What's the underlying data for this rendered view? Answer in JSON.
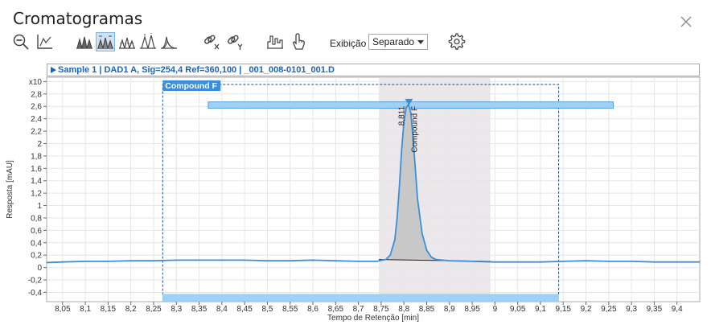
{
  "window": {
    "title": "Cromatogramas",
    "close_icon": "close-icon"
  },
  "toolbar": {
    "buttons": [
      {
        "name": "zoom-out-icon",
        "active": false
      },
      {
        "name": "autoscale-icon",
        "active": false
      },
      {
        "name": "overlay-peaks-icon",
        "active": false
      },
      {
        "name": "separate-peaks-icon",
        "active": true
      },
      {
        "name": "stacked-peaks-icon",
        "active": false
      },
      {
        "name": "peak-labels-icon",
        "active": false
      },
      {
        "name": "peak-shape-icon",
        "active": false
      },
      {
        "name": "link-x-icon",
        "active": false
      },
      {
        "name": "link-y-icon",
        "active": false
      },
      {
        "name": "integration-icon",
        "active": false
      },
      {
        "name": "pointer-hand-icon",
        "active": false
      }
    ],
    "display_label": "Exibição",
    "display_value": "Separado",
    "settings_icon": "gear-icon"
  },
  "chart_header": "Sample 1 | DAD1 A, Sig=254,4 Ref=360,100 | _001_008-0101_001.D",
  "chart_data": {
    "type": "line",
    "xlabel": "Tempo de Retenção [min]",
    "ylabel": "Resposta [mAU]",
    "y_multiplier_label": "x10",
    "xlim": [
      8.015,
      9.45
    ],
    "ylim": [
      -0.55,
      3.07
    ],
    "x_ticks": [
      8.05,
      8.1,
      8.15,
      8.2,
      8.25,
      8.3,
      8.35,
      8.4,
      8.45,
      8.5,
      8.55,
      8.6,
      8.65,
      8.7,
      8.75,
      8.8,
      8.85,
      8.9,
      8.95,
      9.0,
      9.05,
      9.1,
      9.15,
      9.2,
      9.25,
      9.3,
      9.35,
      9.4
    ],
    "x_tick_labels": [
      "8,05",
      "8,1",
      "8,15",
      "8,2",
      "8,25",
      "8,3",
      "8,35",
      "8,4",
      "8,45",
      "8,5",
      "8,55",
      "8,6",
      "8,65",
      "8,7",
      "8,75",
      "8,8",
      "8,85",
      "8,9",
      "8,95",
      "9",
      "9,05",
      "9,1",
      "9,15",
      "9,2",
      "9,25",
      "9,3",
      "9,35",
      "9,4"
    ],
    "y_ticks": [
      -0.4,
      -0.2,
      0,
      0.2,
      0.4,
      0.6,
      0.8,
      1,
      1.2,
      1.4,
      1.6,
      1.8,
      2,
      2.2,
      2.4,
      2.6,
      2.8,
      3
    ],
    "y_tick_labels": [
      "-0,4",
      "-0,2",
      "0",
      "0,2",
      "0,4",
      "0,6",
      "0,8",
      "1",
      "1,2",
      "1,4",
      "1,6",
      "1,8",
      "2",
      "2,2",
      "2,4",
      "2,6",
      "2,8",
      ""
    ],
    "grid": true,
    "series": [
      {
        "color": "#3a8fd8",
        "x": [
          8.015,
          8.05,
          8.1,
          8.15,
          8.2,
          8.25,
          8.3,
          8.35,
          8.4,
          8.45,
          8.5,
          8.55,
          8.6,
          8.65,
          8.7,
          8.74,
          8.76,
          8.77,
          8.78,
          8.785,
          8.79,
          8.795,
          8.8,
          8.805,
          8.81,
          8.815,
          8.82,
          8.825,
          8.83,
          8.84,
          8.85,
          8.86,
          8.87,
          8.9,
          8.95,
          9.0,
          9.05,
          9.1,
          9.15,
          9.2,
          9.25,
          9.3,
          9.35,
          9.4,
          9.45
        ],
        "y": [
          0.08,
          0.09,
          0.1,
          0.1,
          0.11,
          0.11,
          0.12,
          0.12,
          0.12,
          0.12,
          0.11,
          0.11,
          0.12,
          0.11,
          0.1,
          0.1,
          0.13,
          0.2,
          0.45,
          0.8,
          1.3,
          1.9,
          2.35,
          2.58,
          2.63,
          2.5,
          2.1,
          1.6,
          1.1,
          0.55,
          0.28,
          0.17,
          0.13,
          0.11,
          0.1,
          0.09,
          0.09,
          0.09,
          0.1,
          0.11,
          0.1,
          0.1,
          0.09,
          0.09,
          0.09
        ]
      }
    ],
    "peak": {
      "label": "Compound F",
      "rt_label": "8,811",
      "rt": 8.811,
      "apex": 2.63,
      "integration_start": 8.745,
      "integration_end": 8.99,
      "fill_color": "#c8c8c8",
      "window_shade_color": "#ebe7eb",
      "marker_color": "#3a8fd8"
    },
    "compound_window": {
      "label": "Compound F",
      "x_start": 8.27,
      "x_end": 9.14,
      "bar_color": "#9fd0f5"
    },
    "top_bar": {
      "x_start": 8.37,
      "x_end": 9.26,
      "y": 2.62,
      "bar_color": "#9fd0f5"
    }
  }
}
